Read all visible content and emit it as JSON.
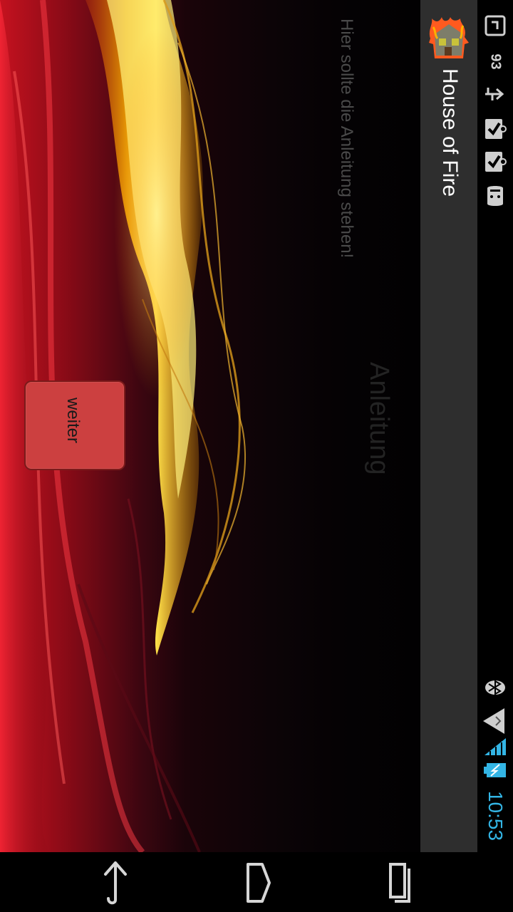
{
  "status_bar": {
    "battery_percent_label": "93",
    "clock": "10:53",
    "icons": [
      "notification-icon",
      "usb-icon",
      "check-icon",
      "check-icon",
      "android-icon",
      "bluetooth-icon",
      "wifi-icon",
      "signal-icon",
      "battery-charging-icon"
    ],
    "clock_color": "#33b5e5"
  },
  "action_bar": {
    "title": "House of Fire",
    "logo": "house-on-fire-logo"
  },
  "content": {
    "instructions": "Hier sollte die Anleitung stehen!",
    "section_title": "Anleitung",
    "weiter_label": "weiter",
    "button_color": "#cc4040"
  },
  "nav_bar": {
    "buttons": [
      "back-icon",
      "home-icon",
      "recents-icon"
    ]
  }
}
